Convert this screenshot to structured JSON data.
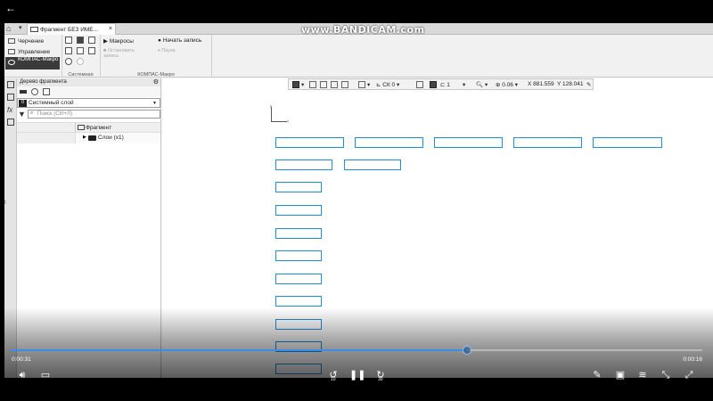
{
  "top": {
    "back_icon": "back-arrow-icon"
  },
  "watermark": "www.BANDICAM.com",
  "tabs": {
    "doc_tab_label": "Фрагмент БЕЗ ИМЕ...",
    "close": "×"
  },
  "ribbon": {
    "left_items": [
      "Черчение",
      "Управление",
      "КОМПАС-Макро"
    ],
    "system_label": "Системная",
    "macro": {
      "macros": "Макросы",
      "start_record": "Начать запись",
      "stop_record": "Остановить запись",
      "pause": "Пауза",
      "group_label": "КОМПАС-Макро"
    }
  },
  "tree": {
    "title": "Дерево фрагмента",
    "layer_num": "0",
    "layer_name": "Системный слой",
    "search_placeholder": "Поиск (Ctrl+Л)",
    "header": "Фрагмент",
    "layers_item": "Слои (x1)"
  },
  "canvas_toolbar": {
    "cs": "СК 0",
    "step": "1",
    "zoom": "0.06",
    "x_label": "X",
    "x_value": "881.559",
    "y_label": "Y",
    "y_value": "128.041"
  },
  "player": {
    "time_elapsed": "0:00:31",
    "time_remaining": "0:00:16",
    "progress": 0.66,
    "rewind_secs": "10",
    "forward_secs": "30"
  }
}
